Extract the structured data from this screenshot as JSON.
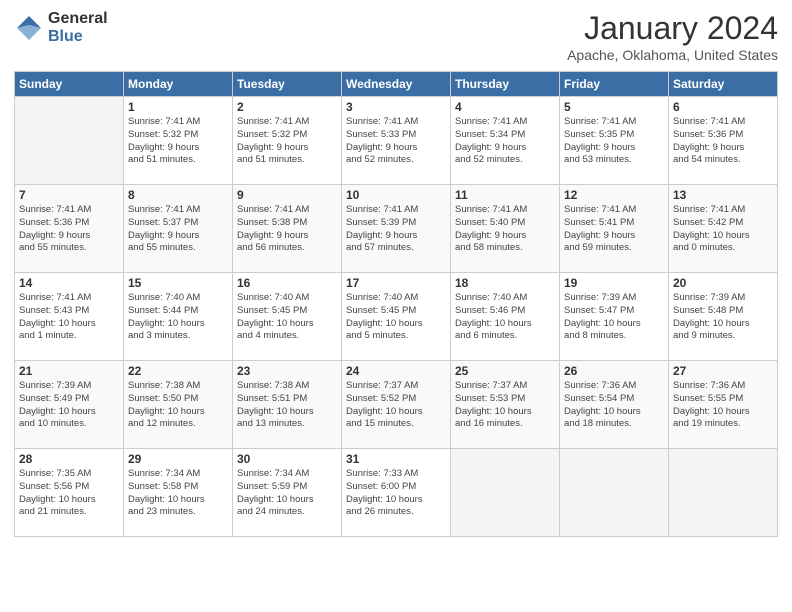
{
  "logo": {
    "general": "General",
    "blue": "Blue"
  },
  "title": "January 2024",
  "location": "Apache, Oklahoma, United States",
  "days_of_week": [
    "Sunday",
    "Monday",
    "Tuesday",
    "Wednesday",
    "Thursday",
    "Friday",
    "Saturday"
  ],
  "weeks": [
    [
      {
        "day": "",
        "empty": true
      },
      {
        "day": "1",
        "sunrise": "7:41 AM",
        "sunset": "5:32 PM",
        "daylight": "9 hours and 51 minutes."
      },
      {
        "day": "2",
        "sunrise": "7:41 AM",
        "sunset": "5:32 PM",
        "daylight": "9 hours and 51 minutes."
      },
      {
        "day": "3",
        "sunrise": "7:41 AM",
        "sunset": "5:33 PM",
        "daylight": "9 hours and 52 minutes."
      },
      {
        "day": "4",
        "sunrise": "7:41 AM",
        "sunset": "5:34 PM",
        "daylight": "9 hours and 52 minutes."
      },
      {
        "day": "5",
        "sunrise": "7:41 AM",
        "sunset": "5:35 PM",
        "daylight": "9 hours and 53 minutes."
      },
      {
        "day": "6",
        "sunrise": "7:41 AM",
        "sunset": "5:36 PM",
        "daylight": "9 hours and 54 minutes."
      }
    ],
    [
      {
        "day": "7",
        "sunrise": "7:41 AM",
        "sunset": "5:36 PM",
        "daylight": "9 hours and 55 minutes."
      },
      {
        "day": "8",
        "sunrise": "7:41 AM",
        "sunset": "5:37 PM",
        "daylight": "9 hours and 55 minutes."
      },
      {
        "day": "9",
        "sunrise": "7:41 AM",
        "sunset": "5:38 PM",
        "daylight": "9 hours and 56 minutes."
      },
      {
        "day": "10",
        "sunrise": "7:41 AM",
        "sunset": "5:39 PM",
        "daylight": "9 hours and 57 minutes."
      },
      {
        "day": "11",
        "sunrise": "7:41 AM",
        "sunset": "5:40 PM",
        "daylight": "9 hours and 58 minutes."
      },
      {
        "day": "12",
        "sunrise": "7:41 AM",
        "sunset": "5:41 PM",
        "daylight": "9 hours and 59 minutes."
      },
      {
        "day": "13",
        "sunrise": "7:41 AM",
        "sunset": "5:42 PM",
        "daylight": "10 hours and 0 minutes."
      }
    ],
    [
      {
        "day": "14",
        "sunrise": "7:41 AM",
        "sunset": "5:43 PM",
        "daylight": "10 hours and 1 minute."
      },
      {
        "day": "15",
        "sunrise": "7:40 AM",
        "sunset": "5:44 PM",
        "daylight": "10 hours and 3 minutes."
      },
      {
        "day": "16",
        "sunrise": "7:40 AM",
        "sunset": "5:45 PM",
        "daylight": "10 hours and 4 minutes."
      },
      {
        "day": "17",
        "sunrise": "7:40 AM",
        "sunset": "5:45 PM",
        "daylight": "10 hours and 5 minutes."
      },
      {
        "day": "18",
        "sunrise": "7:40 AM",
        "sunset": "5:46 PM",
        "daylight": "10 hours and 6 minutes."
      },
      {
        "day": "19",
        "sunrise": "7:39 AM",
        "sunset": "5:47 PM",
        "daylight": "10 hours and 8 minutes."
      },
      {
        "day": "20",
        "sunrise": "7:39 AM",
        "sunset": "5:48 PM",
        "daylight": "10 hours and 9 minutes."
      }
    ],
    [
      {
        "day": "21",
        "sunrise": "7:39 AM",
        "sunset": "5:49 PM",
        "daylight": "10 hours and 10 minutes."
      },
      {
        "day": "22",
        "sunrise": "7:38 AM",
        "sunset": "5:50 PM",
        "daylight": "10 hours and 12 minutes."
      },
      {
        "day": "23",
        "sunrise": "7:38 AM",
        "sunset": "5:51 PM",
        "daylight": "10 hours and 13 minutes."
      },
      {
        "day": "24",
        "sunrise": "7:37 AM",
        "sunset": "5:52 PM",
        "daylight": "10 hours and 15 minutes."
      },
      {
        "day": "25",
        "sunrise": "7:37 AM",
        "sunset": "5:53 PM",
        "daylight": "10 hours and 16 minutes."
      },
      {
        "day": "26",
        "sunrise": "7:36 AM",
        "sunset": "5:54 PM",
        "daylight": "10 hours and 18 minutes."
      },
      {
        "day": "27",
        "sunrise": "7:36 AM",
        "sunset": "5:55 PM",
        "daylight": "10 hours and 19 minutes."
      }
    ],
    [
      {
        "day": "28",
        "sunrise": "7:35 AM",
        "sunset": "5:56 PM",
        "daylight": "10 hours and 21 minutes."
      },
      {
        "day": "29",
        "sunrise": "7:34 AM",
        "sunset": "5:58 PM",
        "daylight": "10 hours and 23 minutes."
      },
      {
        "day": "30",
        "sunrise": "7:34 AM",
        "sunset": "5:59 PM",
        "daylight": "10 hours and 24 minutes."
      },
      {
        "day": "31",
        "sunrise": "7:33 AM",
        "sunset": "6:00 PM",
        "daylight": "10 hours and 26 minutes."
      },
      {
        "day": "",
        "empty": true
      },
      {
        "day": "",
        "empty": true
      },
      {
        "day": "",
        "empty": true
      }
    ]
  ]
}
